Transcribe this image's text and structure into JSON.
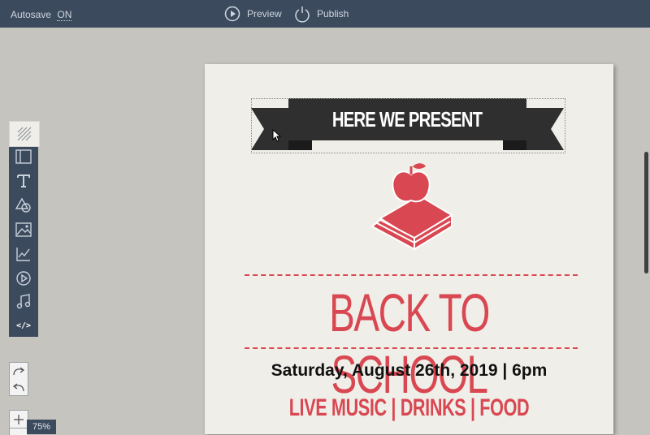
{
  "topbar": {
    "autosave_label": "Autosave",
    "autosave_state": "ON",
    "preview_label": "Preview",
    "publish_label": "Publish"
  },
  "toolbar": {
    "items": [
      {
        "name": "background-tool",
        "icon": "diagonal-lines-icon",
        "active": true
      },
      {
        "name": "layout-tool",
        "icon": "layout-icon"
      },
      {
        "name": "text-tool",
        "icon": "text-T-icon"
      },
      {
        "name": "shapes-tool",
        "icon": "shapes-icon"
      },
      {
        "name": "image-tool",
        "icon": "image-icon"
      },
      {
        "name": "chart-tool",
        "icon": "chart-icon"
      },
      {
        "name": "video-tool",
        "icon": "play-icon"
      },
      {
        "name": "audio-tool",
        "icon": "music-note-icon"
      },
      {
        "name": "embed-tool",
        "icon": "code-icon",
        "label": "</>"
      }
    ]
  },
  "poster": {
    "banner_text": "HERE WE PRESENT",
    "title": "BACK TO SCHOOL",
    "date_line": "Saturday, August 26th, 2019 | 6pm",
    "tagline": "LIVE MUSIC | DRINKS | FOOD"
  },
  "zoom": {
    "level": "75%"
  },
  "colors": {
    "topbar": "#3c4a5d",
    "accent_red": "#d94852",
    "banner_dark": "#2f2f2f",
    "poster_bg": "#f0eee8",
    "canvas_bg": "#c5c4bf"
  }
}
